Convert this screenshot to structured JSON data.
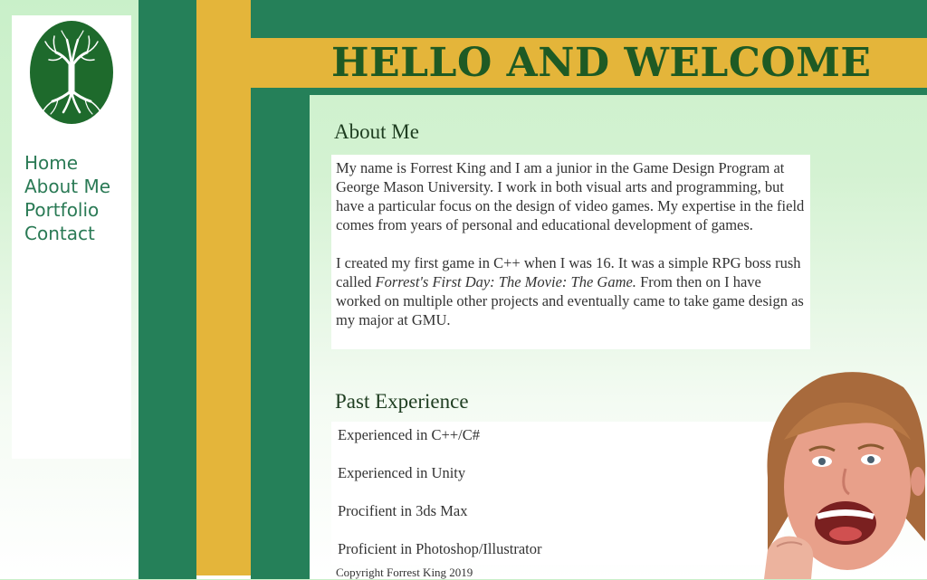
{
  "sidebar": {
    "logo_alt": "tree logo",
    "nav": [
      {
        "label": "Home"
      },
      {
        "label": "About Me"
      },
      {
        "label": "Portfolio"
      },
      {
        "label": "Contact"
      }
    ]
  },
  "header": {
    "title": "HELLO AND WELCOME"
  },
  "about": {
    "heading": "About Me",
    "p1": "My name is Forrest King and I am a junior in the Game Design Program at George Mason University. I work in both visual arts and programming, but have a particular focus on the design of video games. My expertise in the field comes from years of personal and educational development of games.",
    "p2_before": "I created my first game in C++ when I was 16. It was a simple RPG boss rush called ",
    "p2_italic": "Forrest's First Day: The Movie: The Game.",
    "p2_after": " From then on I have worked on multiple other projects and eventually came to take game design as my major at GMU."
  },
  "experience": {
    "heading": "Past Experience",
    "items": [
      "Experienced in C++/C#",
      "Experienced in Unity",
      "Procifient in 3ds Max",
      "Proficient in Photoshop/Illustrator"
    ]
  },
  "footer": {
    "copyright": "Copyright Forrest King 2019"
  },
  "colors": {
    "green": "#258059",
    "yellow": "#e4b53a",
    "dark_green": "#1e5a24",
    "nav_text": "#2a7a55"
  }
}
